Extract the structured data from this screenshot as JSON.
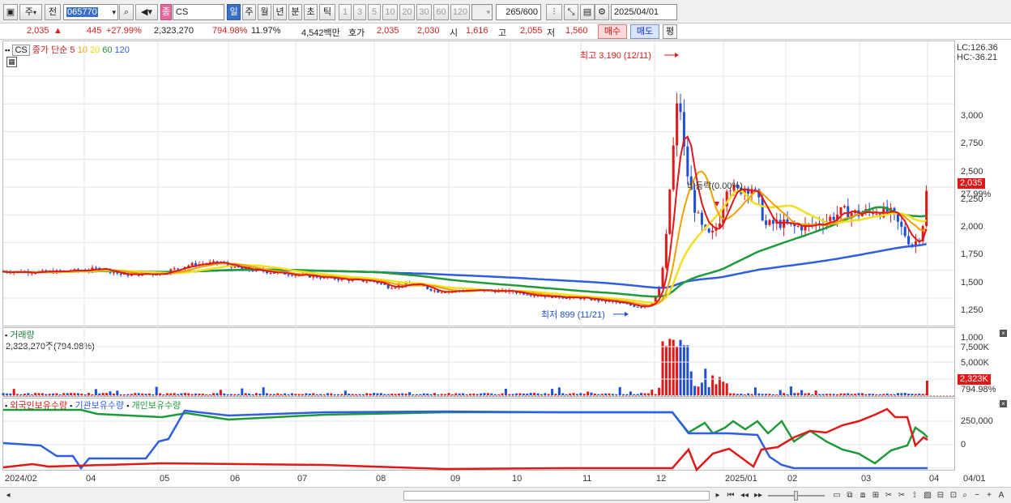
{
  "toolbar": {
    "period_selector": "주",
    "prev_label": "전",
    "stock_code": "065770",
    "stock_name": "CS",
    "sub_badge": "종",
    "period_tabs": [
      "일",
      "주",
      "월",
      "년",
      "분",
      "초",
      "틱"
    ],
    "active_tab": "일",
    "minute_options": [
      "1",
      "3",
      "5",
      "10",
      "20",
      "30",
      "60",
      "120"
    ],
    "view_count": "265",
    "view_total": "/600",
    "date": "2025/04/01"
  },
  "quote": {
    "price": "2,035",
    "arrow": "▲",
    "change": "445",
    "change_pct": "+27.99%",
    "volume": "2,323,270",
    "volume_pct": "794.98%",
    "turnover": "11.97%",
    "amount": "4,542백만",
    "bid_label": "호가",
    "ask_price": "2,035",
    "bid_price": "2,030",
    "open_label": "시",
    "open_price": "1,616",
    "high_label": "고",
    "high_price": "2,055",
    "low_label": "저",
    "low_price": "1,560",
    "buy_label": "매수",
    "sell_label": "매도",
    "flat_label": "평"
  },
  "price_panel": {
    "code_tag": "CS",
    "legend_title": "종가 단순",
    "ma": [
      {
        "label": "5",
        "color": "#e01818"
      },
      {
        "label": "10",
        "color": "#f0a000"
      },
      {
        "label": "20",
        "color": "#f0e020"
      },
      {
        "label": "60",
        "color": "#1f9a3a"
      },
      {
        "label": "120",
        "color": "#2f5fe0"
      }
    ],
    "lc_label": "LC:126.36",
    "hc_label": "HC:-36.21",
    "y_ticks": [
      "3,000",
      "2,750",
      "2,500",
      "2,250",
      "2,000",
      "1,750",
      "1,500",
      "1,250",
      "1,000"
    ],
    "last_price_tag": "2,035",
    "last_change_tag": "27.99%",
    "high_annotation": "최고 3,190 (12/11)",
    "low_annotation": "최저 899 (11/21)",
    "event_annotation": "비등락(0.00%)"
  },
  "volume_panel": {
    "title": "거래량",
    "value": "2,323,270주(794.98%)",
    "y_ticks": [
      "7,500K",
      "5,000K"
    ],
    "last_tag": "2,323K",
    "last_pct": "794.98%"
  },
  "holdings_panel": {
    "legend": [
      {
        "label": "외국인보유수량",
        "color": "#e01818"
      },
      {
        "label": "기관보유수량",
        "color": "#2f5fe0"
      },
      {
        "label": "개인보유수량",
        "color": "#1f9a3a"
      }
    ],
    "y_ticks": [
      "250,000",
      "0"
    ]
  },
  "x_axis": {
    "labels": [
      "2024/02",
      "04",
      "05",
      "06",
      "07",
      "08",
      "09",
      "10",
      "11",
      "12",
      "2025/01",
      "02",
      "03",
      "04",
      "04/01"
    ]
  },
  "colors": {
    "up": "#e01818",
    "down": "#1f4fd6",
    "grid": "#e4e4e4"
  }
}
